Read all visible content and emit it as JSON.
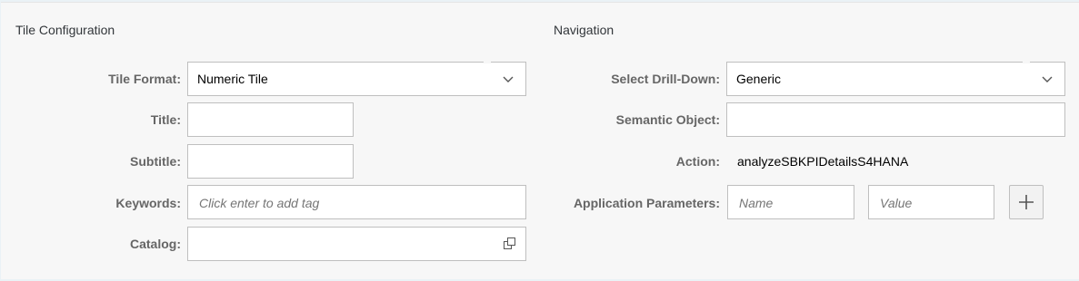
{
  "tile_configuration": {
    "title": "Tile Configuration",
    "tile_format": {
      "label": "Tile Format:",
      "value": "Numeric Tile"
    },
    "title_field": {
      "label": "Title:",
      "value": ""
    },
    "subtitle_field": {
      "label": "Subtitle:",
      "value": ""
    },
    "keywords": {
      "label": "Keywords:",
      "placeholder": "Click enter to add tag"
    },
    "catalog": {
      "label": "Catalog:",
      "value": ""
    }
  },
  "navigation": {
    "title": "Navigation",
    "drilldown": {
      "label": "Select Drill-Down:",
      "value": "Generic"
    },
    "semantic_object": {
      "label": "Semantic Object:",
      "value": ""
    },
    "action": {
      "label": "Action:",
      "value": "analyzeSBKPIDetailsS4HANA"
    },
    "app_params": {
      "label": "Application Parameters:",
      "name_placeholder": "Name",
      "value_placeholder": "Value"
    }
  },
  "icons": {
    "dropdown": "chevron-down-icon",
    "value_help": "value-help-icon",
    "add": "plus-icon"
  }
}
